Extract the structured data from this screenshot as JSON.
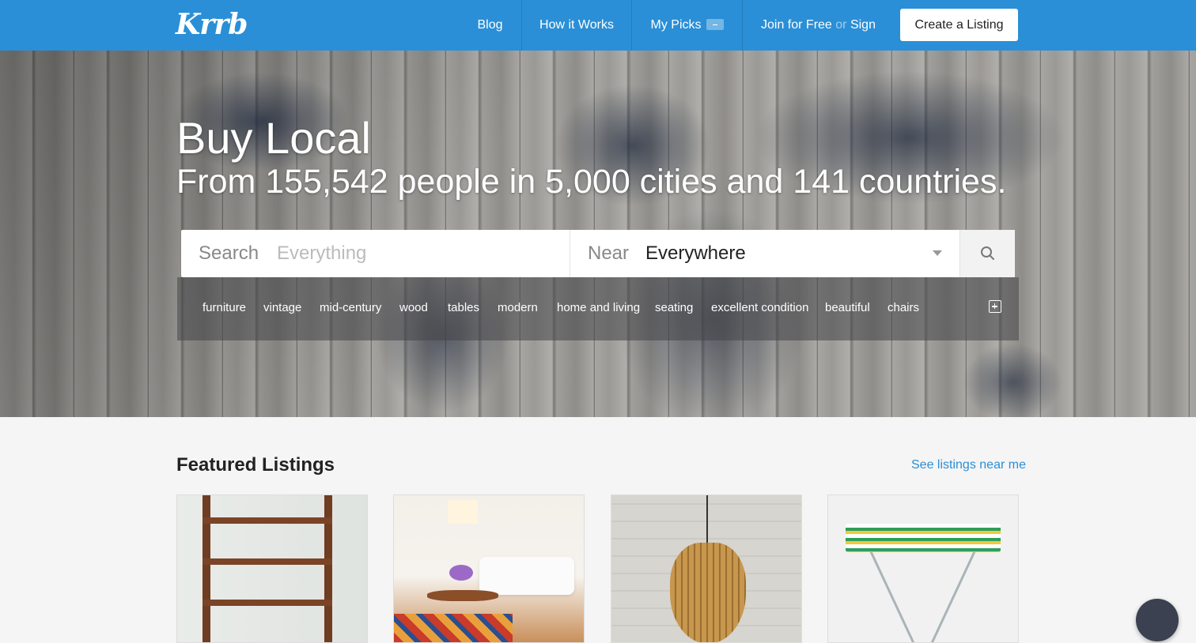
{
  "brand": {
    "logo_text": "Krrb",
    "accent": "#2a8fd6"
  },
  "nav": {
    "blog": "Blog",
    "how_it_works": "How it Works",
    "my_picks": "My Picks",
    "join": "Join for Free",
    "or": "or",
    "sign_in": "Sign in",
    "create_listing": "Create a Listing"
  },
  "hero": {
    "title": "Buy Local",
    "subtitle": "From 155,542 people in 5,000 cities and 141 countries."
  },
  "search": {
    "search_label": "Search",
    "placeholder": "Everything",
    "near_label": "Near",
    "near_value": "Everywhere",
    "submit_icon": "search-icon"
  },
  "tags": [
    "furniture",
    "vintage",
    "mid-century",
    "wood",
    "tables",
    "modern",
    "home and living",
    "seating",
    "excellent condition",
    "beautiful",
    "chairs"
  ],
  "featured": {
    "title": "Featured Listings",
    "near_link": "See listings near me"
  }
}
